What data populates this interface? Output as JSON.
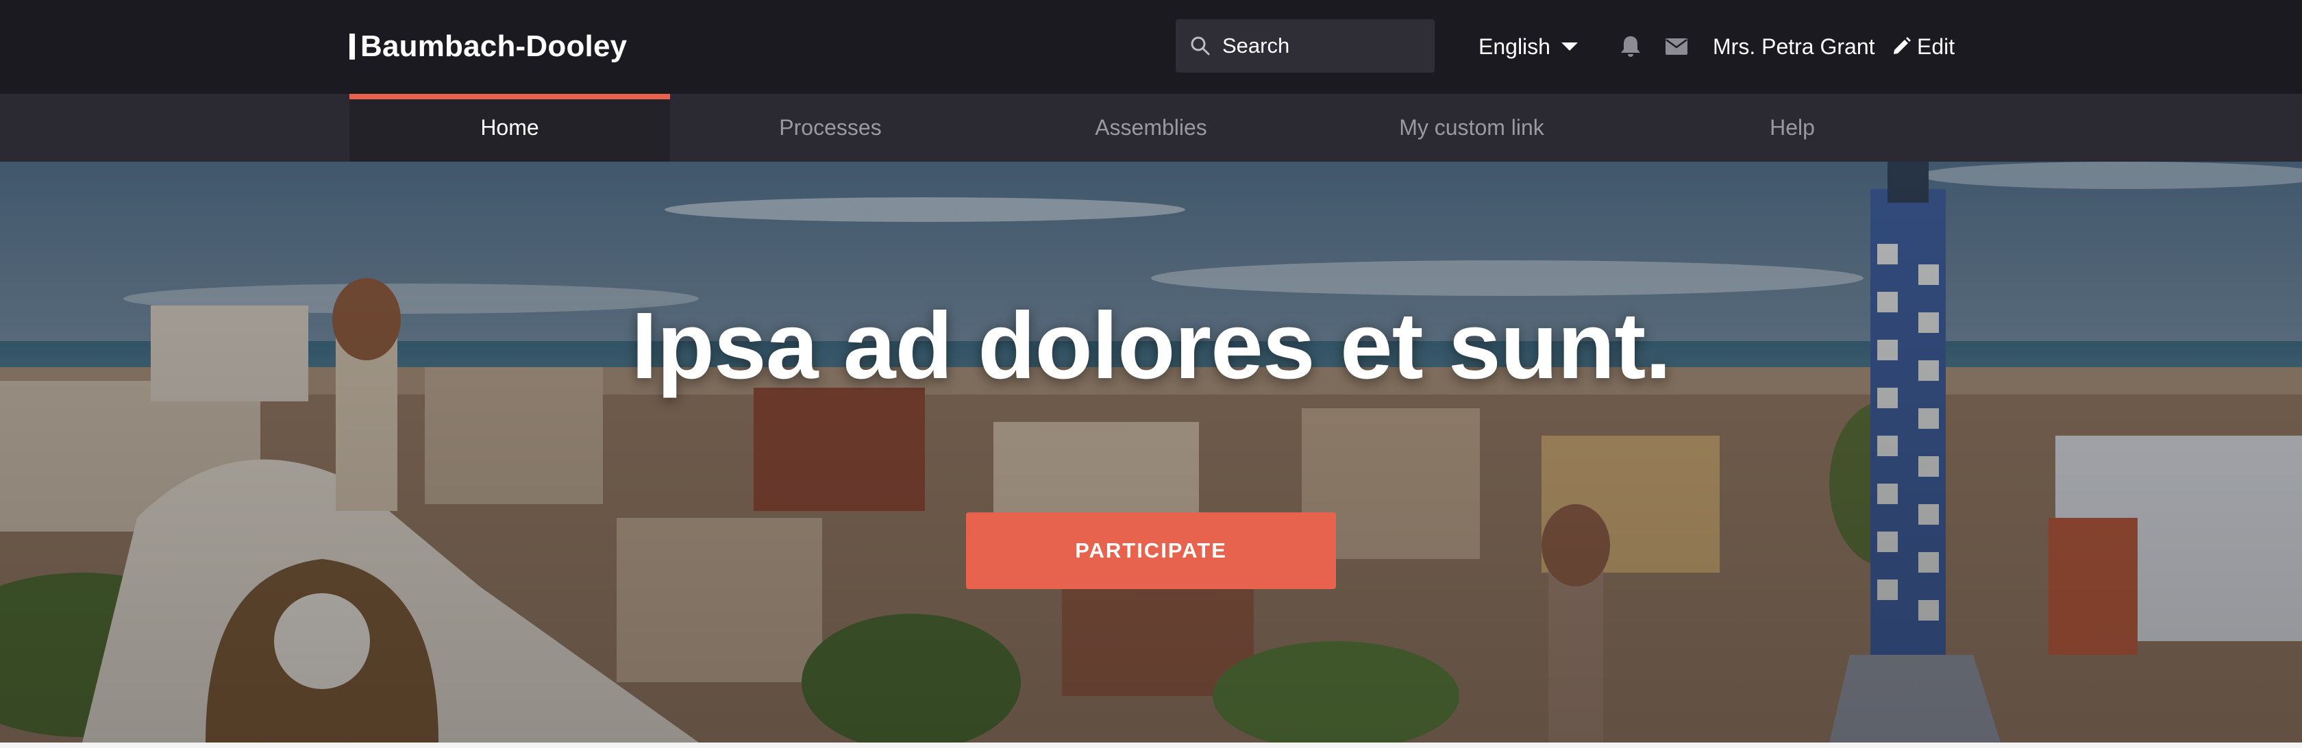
{
  "brand": {
    "name": "Baumbach-Dooley"
  },
  "search": {
    "placeholder": "Search"
  },
  "language": {
    "selected": "English"
  },
  "user": {
    "name": "Mrs. Petra Grant"
  },
  "edit": {
    "label": "Edit"
  },
  "icons": {
    "search": "search-icon",
    "caret": "chevron-down-icon",
    "notifications": "bell-icon",
    "messages": "mail-icon",
    "edit": "pencil-icon"
  },
  "nav": {
    "items": [
      {
        "label": "Home",
        "active": true
      },
      {
        "label": "Processes",
        "active": false
      },
      {
        "label": "Assemblies",
        "active": false
      },
      {
        "label": "My custom link",
        "active": false
      },
      {
        "label": "Help",
        "active": false
      }
    ]
  },
  "hero": {
    "title": "Ipsa ad dolores et sunt.",
    "cta_label": "PARTICIPATE"
  },
  "colors": {
    "topbar": "#1b1a20",
    "nav": "#2b2931",
    "accent": "#e8634e"
  }
}
